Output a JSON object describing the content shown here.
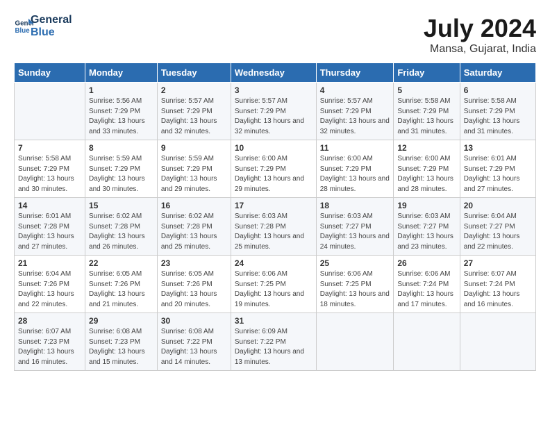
{
  "header": {
    "logo_line1": "General",
    "logo_line2": "Blue",
    "title": "July 2024",
    "subtitle": "Mansa, Gujarat, India"
  },
  "days_of_week": [
    "Sunday",
    "Monday",
    "Tuesday",
    "Wednesday",
    "Thursday",
    "Friday",
    "Saturday"
  ],
  "weeks": [
    [
      {
        "day": "",
        "info": ""
      },
      {
        "day": "1",
        "info": "Sunrise: 5:56 AM\nSunset: 7:29 PM\nDaylight: 13 hours\nand 33 minutes."
      },
      {
        "day": "2",
        "info": "Sunrise: 5:57 AM\nSunset: 7:29 PM\nDaylight: 13 hours\nand 32 minutes."
      },
      {
        "day": "3",
        "info": "Sunrise: 5:57 AM\nSunset: 7:29 PM\nDaylight: 13 hours\nand 32 minutes."
      },
      {
        "day": "4",
        "info": "Sunrise: 5:57 AM\nSunset: 7:29 PM\nDaylight: 13 hours\nand 32 minutes."
      },
      {
        "day": "5",
        "info": "Sunrise: 5:58 AM\nSunset: 7:29 PM\nDaylight: 13 hours\nand 31 minutes."
      },
      {
        "day": "6",
        "info": "Sunrise: 5:58 AM\nSunset: 7:29 PM\nDaylight: 13 hours\nand 31 minutes."
      }
    ],
    [
      {
        "day": "7",
        "info": "Sunrise: 5:58 AM\nSunset: 7:29 PM\nDaylight: 13 hours\nand 30 minutes."
      },
      {
        "day": "8",
        "info": "Sunrise: 5:59 AM\nSunset: 7:29 PM\nDaylight: 13 hours\nand 30 minutes."
      },
      {
        "day": "9",
        "info": "Sunrise: 5:59 AM\nSunset: 7:29 PM\nDaylight: 13 hours\nand 29 minutes."
      },
      {
        "day": "10",
        "info": "Sunrise: 6:00 AM\nSunset: 7:29 PM\nDaylight: 13 hours\nand 29 minutes."
      },
      {
        "day": "11",
        "info": "Sunrise: 6:00 AM\nSunset: 7:29 PM\nDaylight: 13 hours\nand 28 minutes."
      },
      {
        "day": "12",
        "info": "Sunrise: 6:00 AM\nSunset: 7:29 PM\nDaylight: 13 hours\nand 28 minutes."
      },
      {
        "day": "13",
        "info": "Sunrise: 6:01 AM\nSunset: 7:29 PM\nDaylight: 13 hours\nand 27 minutes."
      }
    ],
    [
      {
        "day": "14",
        "info": "Sunrise: 6:01 AM\nSunset: 7:28 PM\nDaylight: 13 hours\nand 27 minutes."
      },
      {
        "day": "15",
        "info": "Sunrise: 6:02 AM\nSunset: 7:28 PM\nDaylight: 13 hours\nand 26 minutes."
      },
      {
        "day": "16",
        "info": "Sunrise: 6:02 AM\nSunset: 7:28 PM\nDaylight: 13 hours\nand 25 minutes."
      },
      {
        "day": "17",
        "info": "Sunrise: 6:03 AM\nSunset: 7:28 PM\nDaylight: 13 hours\nand 25 minutes."
      },
      {
        "day": "18",
        "info": "Sunrise: 6:03 AM\nSunset: 7:27 PM\nDaylight: 13 hours\nand 24 minutes."
      },
      {
        "day": "19",
        "info": "Sunrise: 6:03 AM\nSunset: 7:27 PM\nDaylight: 13 hours\nand 23 minutes."
      },
      {
        "day": "20",
        "info": "Sunrise: 6:04 AM\nSunset: 7:27 PM\nDaylight: 13 hours\nand 22 minutes."
      }
    ],
    [
      {
        "day": "21",
        "info": "Sunrise: 6:04 AM\nSunset: 7:26 PM\nDaylight: 13 hours\nand 22 minutes."
      },
      {
        "day": "22",
        "info": "Sunrise: 6:05 AM\nSunset: 7:26 PM\nDaylight: 13 hours\nand 21 minutes."
      },
      {
        "day": "23",
        "info": "Sunrise: 6:05 AM\nSunset: 7:26 PM\nDaylight: 13 hours\nand 20 minutes."
      },
      {
        "day": "24",
        "info": "Sunrise: 6:06 AM\nSunset: 7:25 PM\nDaylight: 13 hours\nand 19 minutes."
      },
      {
        "day": "25",
        "info": "Sunrise: 6:06 AM\nSunset: 7:25 PM\nDaylight: 13 hours\nand 18 minutes."
      },
      {
        "day": "26",
        "info": "Sunrise: 6:06 AM\nSunset: 7:24 PM\nDaylight: 13 hours\nand 17 minutes."
      },
      {
        "day": "27",
        "info": "Sunrise: 6:07 AM\nSunset: 7:24 PM\nDaylight: 13 hours\nand 16 minutes."
      }
    ],
    [
      {
        "day": "28",
        "info": "Sunrise: 6:07 AM\nSunset: 7:23 PM\nDaylight: 13 hours\nand 16 minutes."
      },
      {
        "day": "29",
        "info": "Sunrise: 6:08 AM\nSunset: 7:23 PM\nDaylight: 13 hours\nand 15 minutes."
      },
      {
        "day": "30",
        "info": "Sunrise: 6:08 AM\nSunset: 7:22 PM\nDaylight: 13 hours\nand 14 minutes."
      },
      {
        "day": "31",
        "info": "Sunrise: 6:09 AM\nSunset: 7:22 PM\nDaylight: 13 hours\nand 13 minutes."
      },
      {
        "day": "",
        "info": ""
      },
      {
        "day": "",
        "info": ""
      },
      {
        "day": "",
        "info": ""
      }
    ]
  ]
}
